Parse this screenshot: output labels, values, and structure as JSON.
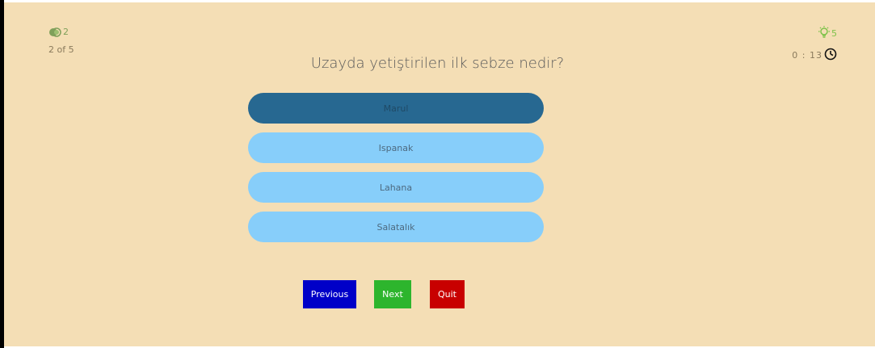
{
  "stats": {
    "lifelines_count": "2",
    "progress": "2 of 5",
    "hints_count": "5",
    "timer": "0 : 13"
  },
  "question": "Uzayda yetiştirilen ilk sebze nedir?",
  "options": [
    {
      "label": "Marul",
      "selected": true
    },
    {
      "label": "Ispanak",
      "selected": false
    },
    {
      "label": "Lahana",
      "selected": false
    },
    {
      "label": "Salatalık",
      "selected": false
    }
  ],
  "buttons": {
    "previous": "Previous",
    "next": "Next",
    "quit": "Quit"
  },
  "colors": {
    "background": "#f4deb5",
    "option": "#87cefa",
    "option_selected": "#276891",
    "previous": "#0000c8",
    "next": "#2db52d",
    "quit": "#c80000"
  },
  "icons": {
    "lifelines": "fifty-fifty-icon",
    "hints": "lightbulb-icon",
    "timer": "clock-icon"
  }
}
